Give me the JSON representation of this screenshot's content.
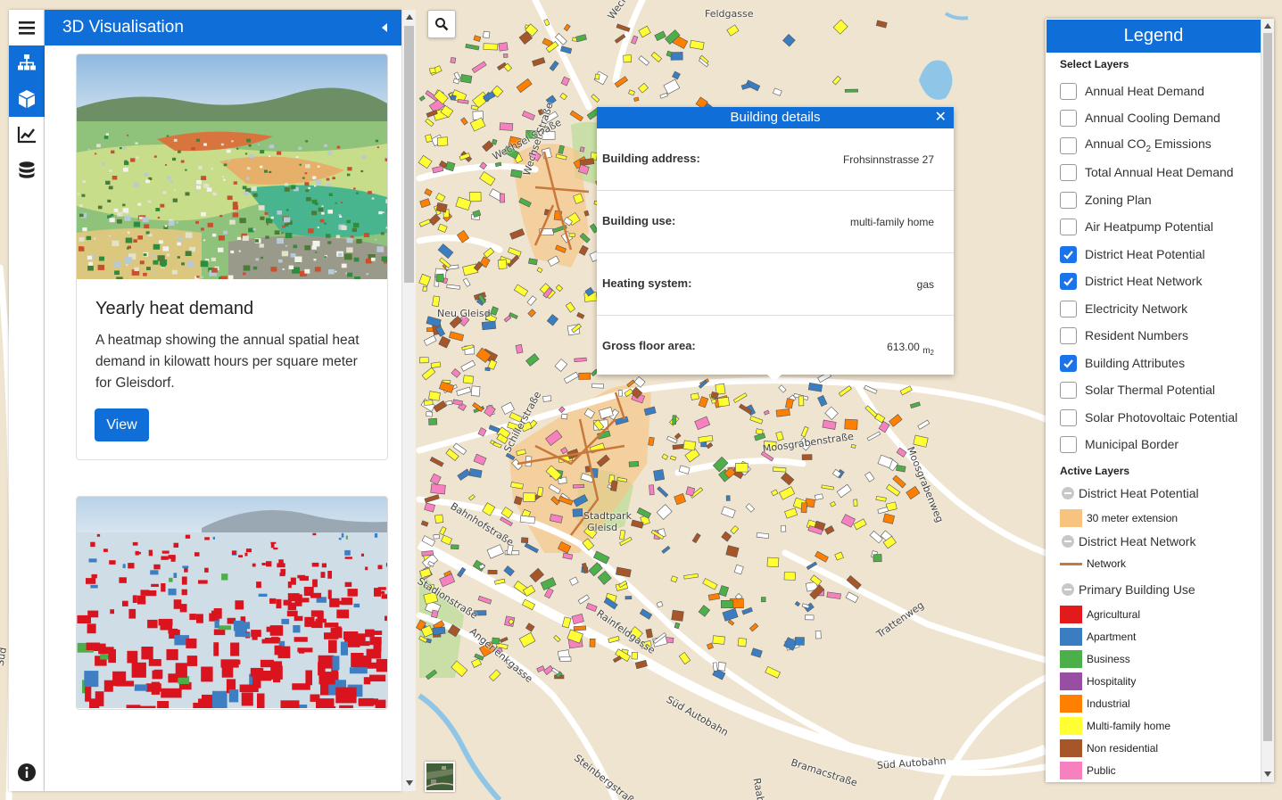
{
  "panel": {
    "title": "3D Visualisation",
    "cards": [
      {
        "title": "Yearly heat demand",
        "description": "A heatmap showing the annual spatial heat demand in kilowatt hours per square meter for Gleisdorf.",
        "button": "View"
      },
      {
        "title": "",
        "description": "",
        "button": ""
      }
    ]
  },
  "rail": {
    "items": [
      {
        "icon": "menu-icon",
        "active": false
      },
      {
        "icon": "sitemap-icon",
        "active": true
      },
      {
        "icon": "cube-icon",
        "active": true
      },
      {
        "icon": "chart-line-icon",
        "active": false
      },
      {
        "icon": "database-icon",
        "active": false
      },
      {
        "icon": "info-icon",
        "active": false
      }
    ]
  },
  "map": {
    "labels": {
      "feldgasse": "Feldgasse",
      "wechsel_strasse_top": "Wechsel",
      "wechsel_strasse": "Wechsel Straße",
      "wechselstr_vert": "Wechsel Straße",
      "moosgrabenstrasse": "Moosgrabenstraße",
      "moosgrabenweg": "Moosgrabenweg",
      "bahnhofstrasse": "Bahnhofstraße",
      "stadionstrasse": "Stadionstraße",
      "stadtpark": "Stadtpark",
      "gleisdorf_short": "Gleisd",
      "neu_gleisdorf": "Neu Gleisd",
      "rainfeldgasse": "Rainfeldgasse",
      "trattenweg": "Trattenweg",
      "sud_autobahn_1": "Süd Autobahn",
      "sud_autobahn_2": "Süd Autobahn",
      "bramacstrasse": "Bramacstraße",
      "steinbergstrasse": "Steinbergstraße",
      "raabweg": "Raabw",
      "schillerstrasse": "Schillerstraße",
      "angerlenkgasse": "Angerlenkgasse",
      "sud": "Süd"
    }
  },
  "popup": {
    "title": "Building details",
    "rows": [
      {
        "label": "Building address:",
        "value": "Frohsinnstrasse 27"
      },
      {
        "label": "Building use:",
        "value": "multi-family home"
      },
      {
        "label": "Heating system:",
        "value": "gas"
      },
      {
        "label": "Gross floor area:",
        "value": "613.00",
        "unit": "m",
        "unit_sub": "2"
      }
    ]
  },
  "legend": {
    "title": "Legend",
    "select_layers_title": "Select Layers",
    "layers": [
      {
        "label": "Annual Heat Demand",
        "checked": false
      },
      {
        "label": "Annual Cooling Demand",
        "checked": false
      },
      {
        "label": "Annual CO",
        "label_sub": "2",
        "label_suffix": " Emissions",
        "checked": false
      },
      {
        "label": "Total Annual Heat Demand",
        "checked": false
      },
      {
        "label": "Zoning Plan",
        "checked": false
      },
      {
        "label": "Air Heatpump Potential",
        "checked": false
      },
      {
        "label": "District Heat Potential",
        "checked": true
      },
      {
        "label": "District Heat Network",
        "checked": true
      },
      {
        "label": "Electricity Network",
        "checked": false
      },
      {
        "label": "Resident Numbers",
        "checked": false
      },
      {
        "label": "Building Attributes",
        "checked": true
      },
      {
        "label": "Solar Thermal Potential",
        "checked": false
      },
      {
        "label": "Solar Photovoltaic Potential",
        "checked": false
      },
      {
        "label": "Municipal Border",
        "checked": false
      }
    ],
    "active_layers_title": "Active Layers",
    "active": [
      {
        "group": "District Heat Potential",
        "items": [
          {
            "label": "30 meter extension",
            "color": "#f8c37e",
            "kind": "box"
          }
        ]
      },
      {
        "group": "District Heat Network",
        "items": [
          {
            "label": "Network",
            "color": "#c8783c",
            "kind": "line"
          }
        ]
      },
      {
        "group": "Primary Building Use",
        "items": [
          {
            "label": "Agricultural",
            "color": "#e31a1c",
            "kind": "box"
          },
          {
            "label": "Apartment",
            "color": "#3a7dc0",
            "kind": "box"
          },
          {
            "label": "Business",
            "color": "#4daf4a",
            "kind": "box"
          },
          {
            "label": "Hospitality",
            "color": "#984ea3",
            "kind": "box"
          },
          {
            "label": "Industrial",
            "color": "#ff7f00",
            "kind": "box"
          },
          {
            "label": "Multi-family home",
            "color": "#ffff33",
            "kind": "box"
          },
          {
            "label": "Non residential",
            "color": "#a65628",
            "kind": "box"
          },
          {
            "label": "Public",
            "color": "#f781bf",
            "kind": "box"
          }
        ]
      }
    ]
  },
  "colors": {
    "accent": "#0f6ed8",
    "map_background": "#efe4cf",
    "road": "#ffffff",
    "water": "#8fc6e8",
    "park": "#c9dfa7",
    "heat_potential": "#f8c37e",
    "network": "#c8783c"
  }
}
